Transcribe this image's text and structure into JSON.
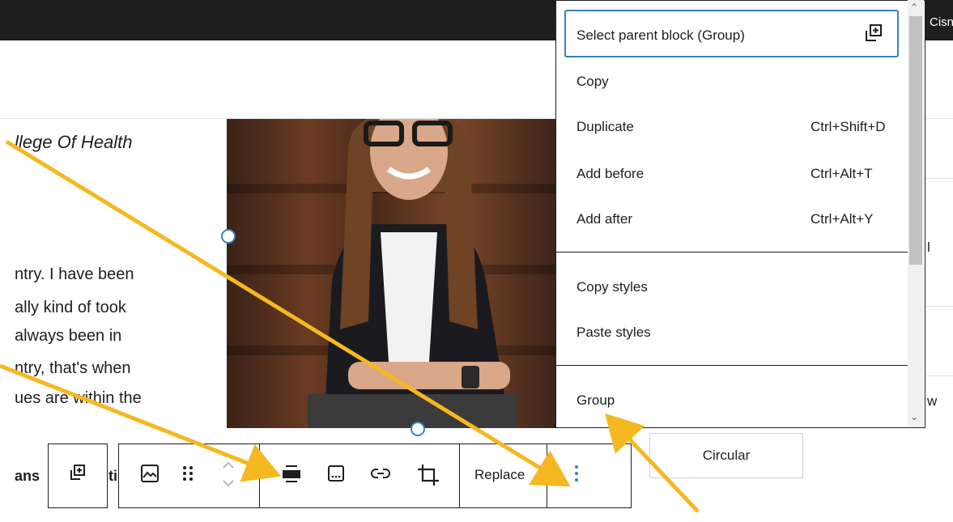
{
  "topbar": {
    "corner_text": "Cisn"
  },
  "content": {
    "subtitle": "llege Of Health",
    "paragraph_lines": [
      "ntry. I have been",
      "ally kind of took",
      "always been in",
      "ntry, that's when",
      "ues are within the"
    ],
    "bold_fragment": "ans",
    "bold_fragment_2": "ti"
  },
  "toolbar": {
    "parent_icon": "select-parent-icon",
    "image_icon": "image-icon",
    "drag_icon": "drag-handle-icon",
    "move_icon": "chevron-up-down-icon",
    "align_icon": "align-icon",
    "caption_icon": "caption-icon",
    "link_icon": "link-icon",
    "crop_icon": "crop-icon",
    "replace_label": "Replace",
    "options_icon": "vertical-ellipsis-icon"
  },
  "menu": {
    "select_parent_label": "Select parent block (Group)",
    "items": [
      {
        "label": "Copy",
        "shortcut": ""
      },
      {
        "label": "Duplicate",
        "shortcut": "Ctrl+Shift+D"
      },
      {
        "label": "Add before",
        "shortcut": "Ctrl+Alt+T"
      },
      {
        "label": "Add after",
        "shortcut": "Ctrl+Alt+Y"
      }
    ],
    "style_items": [
      {
        "label": "Copy styles"
      },
      {
        "label": "Paste styles"
      }
    ],
    "group_label": "Group"
  },
  "sidebar": {
    "circular_label": "Circular",
    "frag_l": "l",
    "frag_w": "w"
  },
  "colors": {
    "accent": "#3582c4",
    "arrow": "#f5b820",
    "topbar": "#1e1e1e"
  }
}
